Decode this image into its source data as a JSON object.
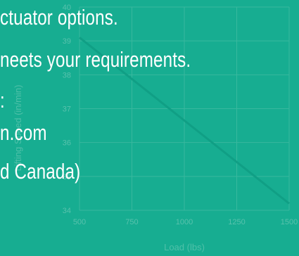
{
  "chart_data": {
    "type": "line",
    "xlabel": "Load (lbs)",
    "ylabel": "Lifting Speed (in/min)",
    "x_ticks": [
      500,
      750,
      1000,
      1250,
      1500
    ],
    "y_ticks": [
      34,
      35,
      36,
      37,
      38,
      39,
      40
    ],
    "xlim": [
      500,
      1500
    ],
    "ylim": [
      34,
      40
    ],
    "grid": true,
    "series": [
      {
        "x": [
          500,
          1500
        ],
        "y": [
          39.1,
          34.2
        ]
      }
    ],
    "colors": {
      "background": "#17ad91",
      "grid": "#38b89e",
      "line": "#109f85",
      "tick_text": "#58c2ad"
    }
  },
  "overlay": {
    "lines": [
      "ctuator options.",
      "neets your requirements.",
      ":",
      "n.com",
      "d Canada)"
    ]
  }
}
